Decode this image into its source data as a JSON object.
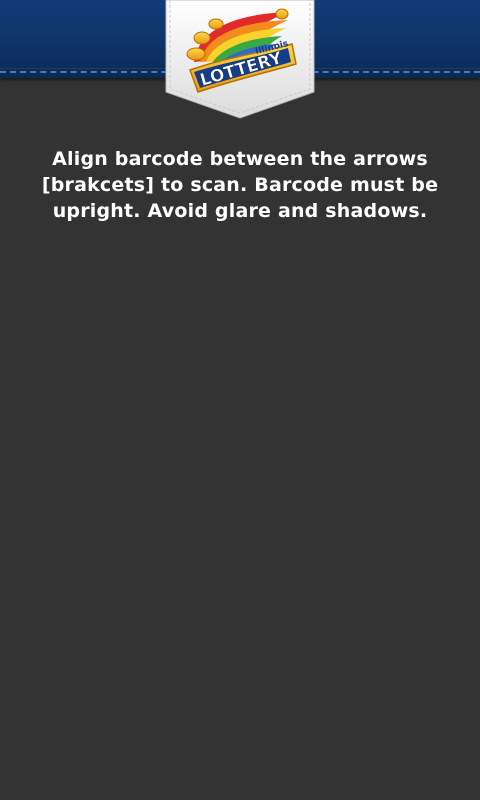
{
  "header": {
    "brand_color": "#0f3468",
    "stitch_color": "#5f86bd"
  },
  "logo": {
    "icon": "illinois-lottery-logo-icon",
    "state_text": "Illinois",
    "brand_text": "LOTTERY"
  },
  "scanner": {
    "instructions": "Align barcode between the arrows [brakcets] to scan. Barcode must be upright. Avoid glare and shadows.",
    "background_color": "#333333"
  }
}
